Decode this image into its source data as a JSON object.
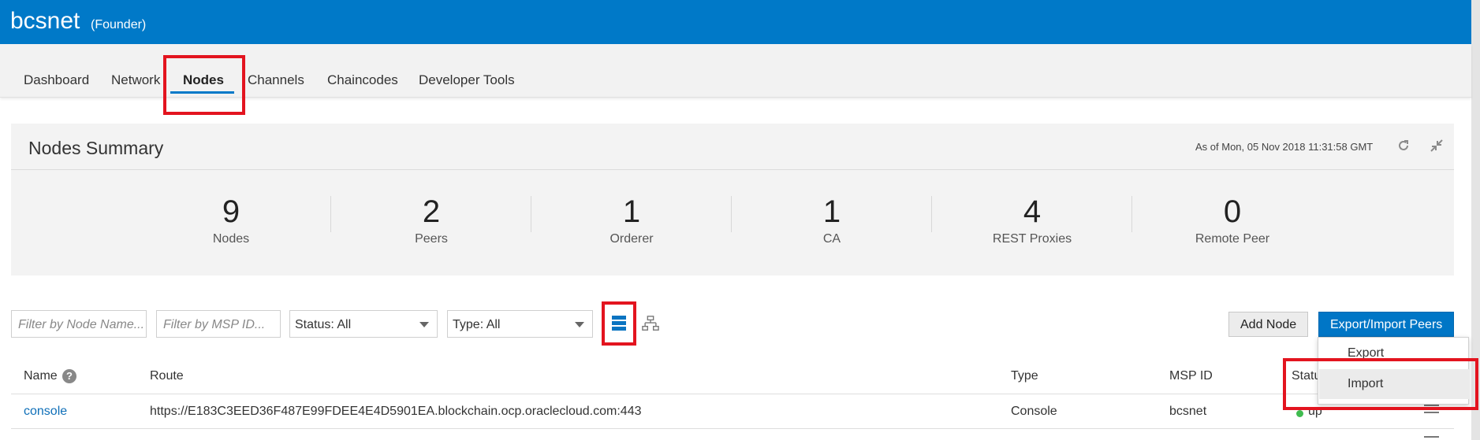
{
  "header": {
    "title": "bcsnet",
    "role": "(Founder)"
  },
  "nav": {
    "tabs": [
      {
        "label": "Dashboard"
      },
      {
        "label": "Network"
      },
      {
        "label": "Nodes",
        "active": true
      },
      {
        "label": "Channels"
      },
      {
        "label": "Chaincodes"
      },
      {
        "label": "Developer Tools"
      }
    ]
  },
  "summary": {
    "title": "Nodes Summary",
    "as_of": "As of Mon, 05 Nov 2018 11:31:58 GMT",
    "icons": [
      "refresh-icon",
      "collapse-icon"
    ],
    "stats": [
      {
        "value": "9",
        "label": "Nodes"
      },
      {
        "value": "2",
        "label": "Peers"
      },
      {
        "value": "1",
        "label": "Orderer"
      },
      {
        "value": "1",
        "label": "CA"
      },
      {
        "value": "4",
        "label": "REST Proxies"
      },
      {
        "value": "0",
        "label": "Remote Peer"
      }
    ]
  },
  "filters": {
    "node_name_placeholder": "Filter by Node Name...",
    "msp_id_placeholder": "Filter by MSP ID...",
    "status_value": "Status: All",
    "type_value": "Type: All"
  },
  "toolbar": {
    "add_node_label": "Add Node",
    "export_import_label": "Export/Import Peers",
    "menu": {
      "export_label": "Export",
      "import_label": "Import"
    }
  },
  "table": {
    "columns": [
      "Name",
      "Route",
      "Type",
      "MSP ID",
      "Statu"
    ],
    "rows": [
      {
        "name": "console",
        "route": "https://E183C3EED36F487E99FDEE4E4D5901EA.blockchain.ocp.oraclecloud.com:443",
        "type": "Console",
        "msp_id": "bcsnet",
        "status": "up"
      }
    ]
  },
  "colors": {
    "brand_blue": "#0079c8",
    "highlight_red": "#e3141f",
    "status_up": "#3fbb4f"
  }
}
